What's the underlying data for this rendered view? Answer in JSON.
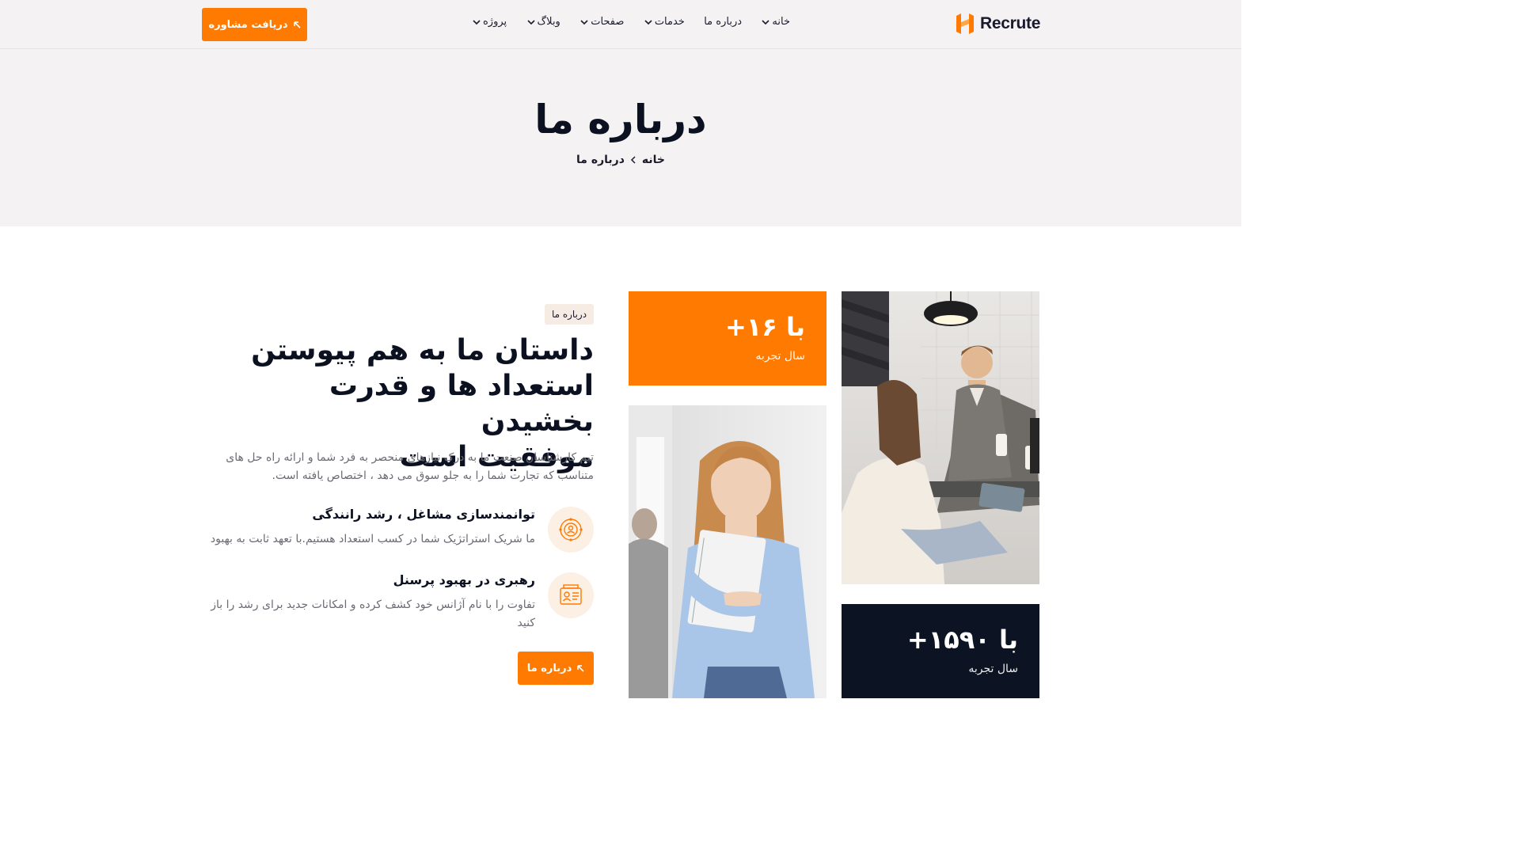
{
  "header": {
    "logo_text": "Recrute",
    "nav": [
      {
        "label": "خانه",
        "has_dropdown": true
      },
      {
        "label": "درباره ما",
        "has_dropdown": false
      },
      {
        "label": "خدمات",
        "has_dropdown": true
      },
      {
        "label": "صفحات",
        "has_dropdown": true
      },
      {
        "label": "وبلاگ",
        "has_dropdown": true
      },
      {
        "label": "پروژه",
        "has_dropdown": true
      }
    ],
    "cta_label": "دریافت مشاوره"
  },
  "hero": {
    "title": "درباره ما",
    "breadcrumb": [
      "خانه",
      "درباره ما"
    ]
  },
  "about": {
    "tag": "درباره ما",
    "heading_lines": [
      "داستان ما به هم پیوستن",
      "استعداد ها و قدرت بخشیدن",
      "موفقیت است"
    ],
    "description": "تیم کارشناسان صنعت ما به درک نیازهای منحصر به فرد شما و ارائه راه حل های متناسب که تجارت شما را به جلو سوق می دهد ، اختصاص یافته است.",
    "features": [
      {
        "icon": "network-people-icon",
        "title": "توانمندسازی مشاغل ، رشد رانندگی",
        "text": "ما شریک استراتژیک شما در کسب استعداد هستیم.با تعهد ثابت به بهبود"
      },
      {
        "icon": "id-card-icon",
        "title": "رهبری در بهبود پرسنل",
        "text": "تفاوت را با نام آژانس خود کشف کرده و امکانات جدید برای رشد را باز کنید"
      }
    ],
    "button_label": "درباره ما"
  },
  "stats": {
    "orange": {
      "number": "با ۱۶+",
      "label": "سال تجربه"
    },
    "dark": {
      "number": "با ۱۵۹۰+",
      "label": "سال تجربه"
    }
  },
  "images": {
    "team": "team-meeting-photo",
    "woman": "woman-with-notebook-photo"
  },
  "colors": {
    "accent": "#ff7a00",
    "dark": "#0c1424",
    "hero_bg": "#f4f2f3",
    "icon_bg": "#fcefe4"
  }
}
